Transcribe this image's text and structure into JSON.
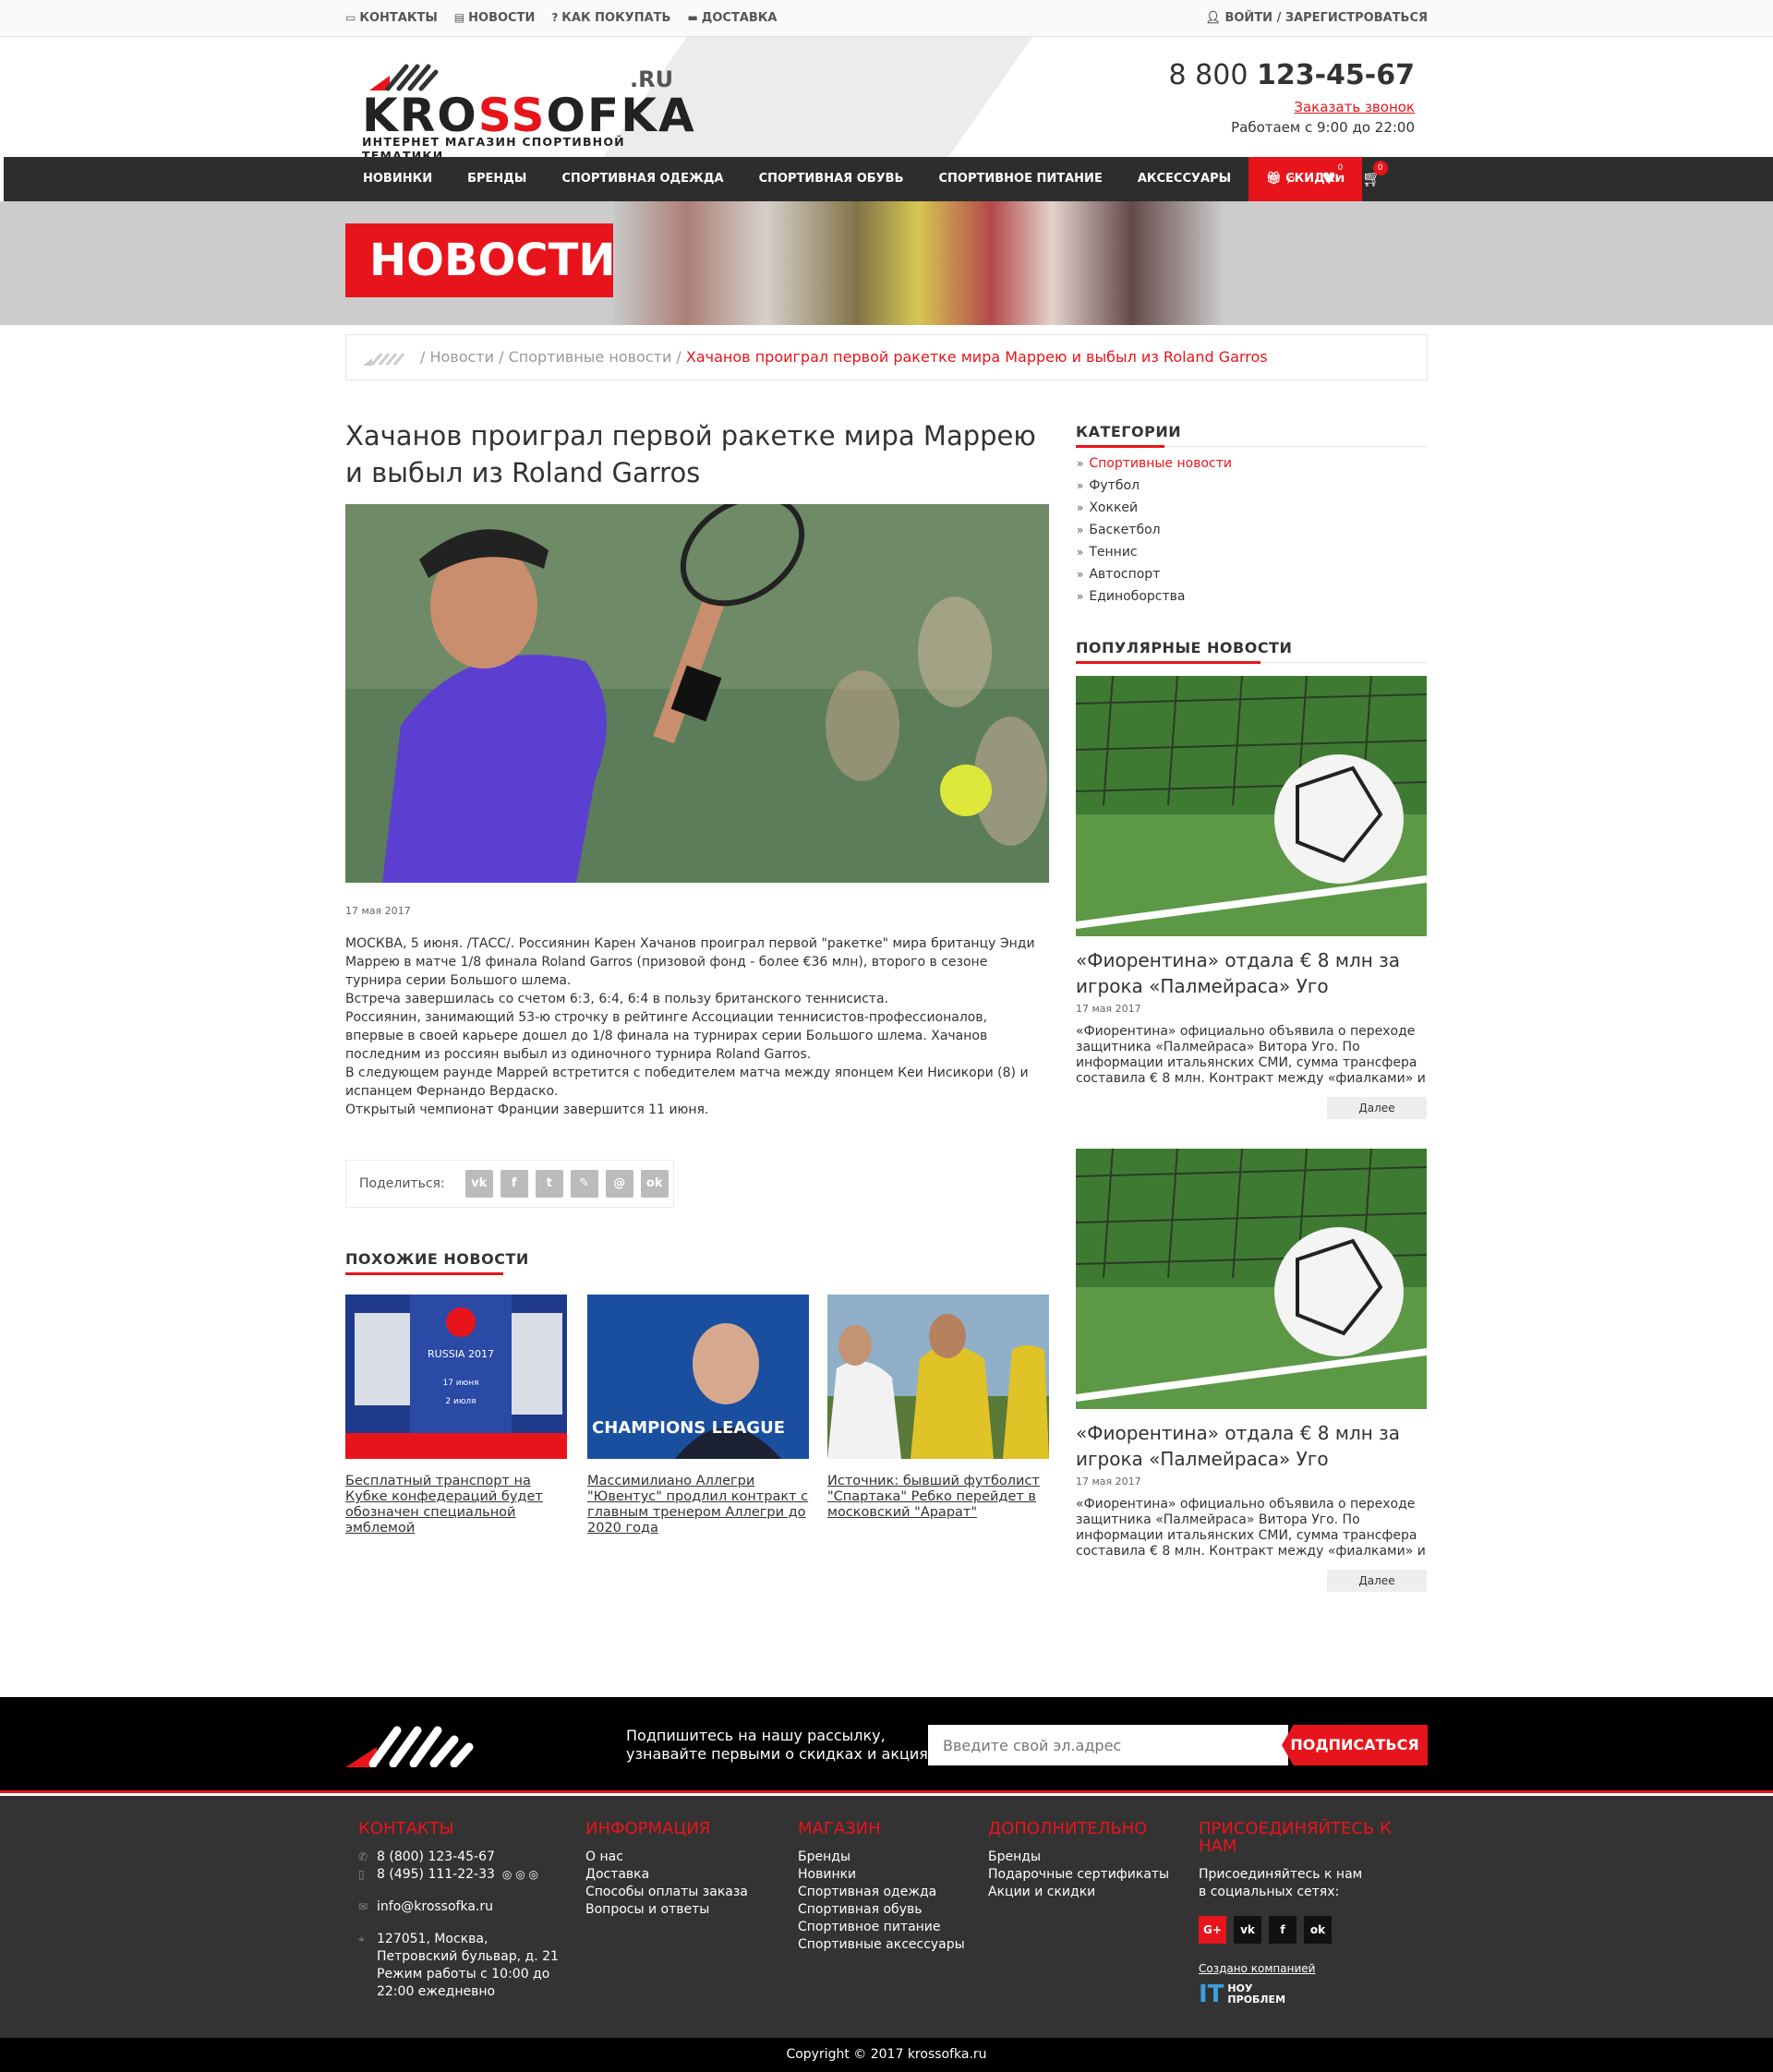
{
  "topbar": {
    "links": [
      {
        "icon": "contacts-card-icon",
        "glyph": "▭",
        "label": "КОНТАКТЫ"
      },
      {
        "icon": "news-doc-icon",
        "glyph": "▤",
        "label": "НОВОСТИ"
      },
      {
        "icon": "question-icon",
        "glyph": "?",
        "label": "КАК ПОКУПАТЬ"
      },
      {
        "icon": "truck-icon",
        "glyph": "▬",
        "label": "ДОСТАВКА"
      }
    ],
    "login": "ВОЙТИ / ЗАРЕГИСТРОВАТЬСЯ"
  },
  "logo": {
    "part1": "KRO",
    "part2": "SS",
    "part3": "OFKA",
    "ru": ".RU",
    "tagline": "ИНТЕРНЕТ МАГАЗИН СПОРТИВНОЙ ТЕМАТИКИ"
  },
  "contact": {
    "phone_prefix": "8 800",
    "phone_main": "123-45-67",
    "callback": "Заказать звонок",
    "hours": "Работаем с 9:00 до 22:00"
  },
  "nav": {
    "items": [
      "НОВИНКИ",
      "БРЕНДЫ",
      "СПОРТИВНАЯ ОДЕЖДА",
      "СПОРТИВНАЯ ОБУВЬ",
      "СПОРТИВНОЕ ПИТАНИЕ",
      "АКСЕССУАРЫ"
    ],
    "sale": "СКИДКИ",
    "wishlist_count": "0",
    "cart_count": "0"
  },
  "banner": {
    "title": "НОВОСТИ"
  },
  "breadcrumb": {
    "items": [
      "Новости",
      "Спортивные новости"
    ],
    "current": "Хачанов проиграл первой ракетке мира Маррею и выбыл из Roland Garros"
  },
  "article": {
    "title": "Хачанов проиграл первой ракетке мира Маррею и выбыл из Roland Garros",
    "date": "17 мая 2017",
    "paragraphs": [
      "МОСКВА, 5 июня. /ТАСС/. Россиянин Карен Хачанов проиграл первой \"ракетке\" мира британцу Энди Маррею в матче 1/8 финала Roland Garros (призовой фонд - более €36 млн), второго в сезоне турнира серии Большого шлема.",
      "Встреча завершилась со счетом 6:3, 6:4, 6:4 в пользу британского теннисиста.",
      "Россиянин, занимающий 53-ю строчку в рейтинге Ассоциации теннисистов-профессионалов, впервые в своей карьере дошел до 1/8 финала на турнирах серии Большого шлема. Хачанов последним из россиян выбыл из одиночного турнира Roland Garros.",
      "В следующем раунде Маррей встретится с победителем матча между японцем Кеи Нисикори (8) и испанцем Фернандо Вердаско.",
      "Открытый чемпионат Франции завершится 11 июня."
    ],
    "share_label": "Поделиться:"
  },
  "similar": {
    "title": "ПОХОЖИЕ НОВОСТИ",
    "items": [
      "Бесплатный транспорт на Кубке конфедераций будет обозначен специальной эмблемой",
      "Массимилиано Аллегри \"Ювентус\" продлил контракт с главным тренером Аллегри до 2020 года",
      "Источник: бывший футболист \"Спартака\" Ребко перейдет в московский \"Арарат\""
    ],
    "image_texts": {
      "russia": "RUSSIA 2017",
      "date1": "17 июня",
      "date2": "2 июля",
      "champions": "CHAMPIONS LEAGUE"
    }
  },
  "sidebar": {
    "categories_title": "КАТЕГОРИИ",
    "categories": [
      "Спортивные новости",
      "Футбол",
      "Хоккей",
      "Баскетбол",
      "Теннис",
      "Автоспорт",
      "Единоборства"
    ],
    "popular_title": "ПОПУЛЯРНЫЕ НОВОСТИ",
    "popular": [
      {
        "title": "«Фиорентина» отдала € 8 млн за игрока «Палмейраса» Уго",
        "date": "17 мая 2017",
        "text": "«Фиорентина» официально объявила о переходе защитника «Палмейраса» Витора Уго. По информации итальянских СМИ, сумма трансфера составила € 8 млн. Контракт между «фиалками» и",
        "more": "Далее"
      },
      {
        "title": "«Фиорентина» отдала € 8 млн за игрока «Палмейраса» Уго",
        "date": "17 мая 2017",
        "text": "«Фиорентина» официально объявила о переходе защитника «Палмейраса» Витора Уго. По информации итальянских СМИ, сумма трансфера составила € 8 млн. Контракт между «фиалками» и",
        "more": "Далее"
      }
    ]
  },
  "subscribe": {
    "line1": "Подпишитесь на нашу рассылку,",
    "line2": "узнавайте первыми о скидках и акциях!",
    "placeholder": "Введите свой эл.адрес",
    "button": "ПОДПИСАТЬСЯ"
  },
  "footer": {
    "contacts_title": "КОНТАКТЫ",
    "phone1": "8 (800) 123-45-67",
    "phone2": "8 (495) 111-22-33",
    "email": "info@krossofka.ru",
    "address": [
      "127051, Москва,",
      "Петровский бульвар, д. 21",
      "Режим работы с 10:00 до",
      "22:00 ежедневно"
    ],
    "info_title": "ИНФОРМАЦИЯ",
    "info_links": [
      "О нас",
      "Доставка",
      "Способы оплаты заказа",
      "Вопросы и ответы"
    ],
    "shop_title": "МАГАЗИН",
    "shop_links": [
      "Бренды",
      "Новинки",
      "Спортивная одежда",
      "Спортивная обувь",
      "Спортивное питание",
      "Спортивные аксессуары"
    ],
    "extra_title": "ДОПОЛНИТЕЛЬНО",
    "extra_links": [
      "Бренды",
      "Подарочные сертификаты",
      "Акции и скидки"
    ],
    "join_title": "ПРИСОЕДИНЯЙТЕСЬ К НАМ",
    "join_line1": "Присоединяйтесь к нам",
    "join_line2": "в социальных сетях:",
    "created_by": "Создано компанией",
    "company_line1": "НОУ",
    "company_line2": "ПРОБЛЕМ"
  },
  "copyright": "Copyright © 2017 krossofka.ru"
}
